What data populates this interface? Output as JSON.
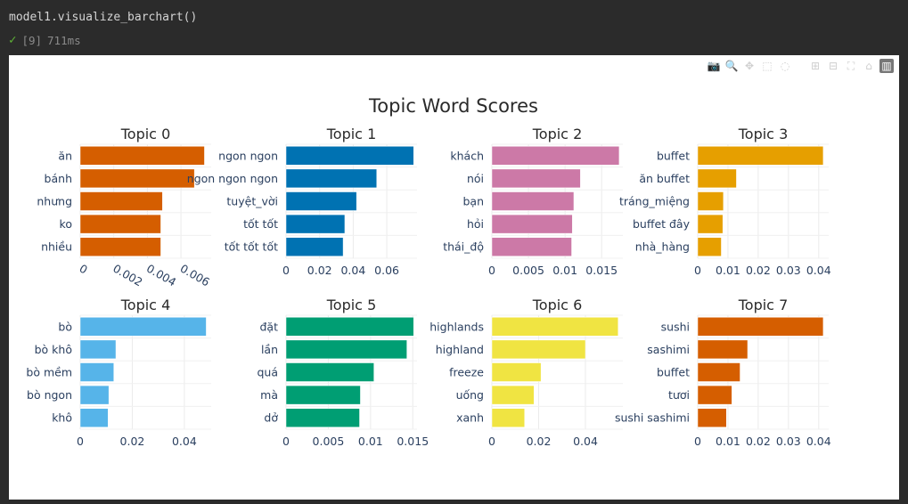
{
  "cell": {
    "code": "model1.visualize_barchart()",
    "exec_count": "[9]",
    "duration": "711ms"
  },
  "modebar_icons": [
    "camera-icon",
    "zoom-icon",
    "pan-icon",
    "box-select-icon",
    "lasso-icon",
    "zoom-in-icon",
    "zoom-out-icon",
    "autoscale-icon",
    "home-icon",
    "plotly-logo-icon"
  ],
  "chart_data": {
    "type": "bar",
    "title": "Topic Word Scores",
    "orientation": "horizontal",
    "grid": true,
    "subplots": [
      {
        "title": "Topic 0",
        "color": "#D55E00",
        "categories": [
          "ăn",
          "bánh",
          "nhưng",
          "ko",
          "nhiều"
        ],
        "values": [
          0.0074,
          0.0068,
          0.0049,
          0.0048,
          0.0048
        ],
        "xmax": 0.0078,
        "ticks": [
          0,
          0.002,
          0.004,
          0.006
        ],
        "tick_labels": [
          "0",
          "0.002",
          "0.004",
          "0.006"
        ],
        "tick_rotated": true
      },
      {
        "title": "Topic 1",
        "color": "#0072B2",
        "categories": [
          "ngon ngon",
          "ngon ngon ngon",
          "tuyệt_vời",
          "tốt tốt",
          "tốt tốt tốt"
        ],
        "values": [
          0.076,
          0.054,
          0.042,
          0.035,
          0.034
        ],
        "xmax": 0.078,
        "ticks": [
          0,
          0.02,
          0.04,
          0.06
        ],
        "tick_labels": [
          "0",
          "0.02",
          "0.04",
          "0.06"
        ]
      },
      {
        "title": "Topic 2",
        "color": "#CC79A7",
        "categories": [
          "khách",
          "nói",
          "bạn",
          "hỏi",
          "thái_độ"
        ],
        "values": [
          0.0174,
          0.0121,
          0.0112,
          0.011,
          0.0109
        ],
        "xmax": 0.0179,
        "ticks": [
          0,
          0.005,
          0.01,
          0.015
        ],
        "tick_labels": [
          "0",
          "0.005",
          "0.01",
          "0.015"
        ]
      },
      {
        "title": "Topic 3",
        "color": "#E69F00",
        "categories": [
          "buffet",
          "ăn buffet",
          "tráng_miệng",
          "buffet đây",
          "nhà_hàng"
        ],
        "values": [
          0.0415,
          0.0128,
          0.0085,
          0.0083,
          0.0078
        ],
        "xmax": 0.0433,
        "ticks": [
          0,
          0.01,
          0.02,
          0.03,
          0.04
        ],
        "tick_labels": [
          "0",
          "0.01",
          "0.02",
          "0.03",
          "0.04"
        ]
      },
      {
        "title": "Topic 4",
        "color": "#56B4E9",
        "categories": [
          "bò",
          "bò khô",
          "bò mềm",
          "bò ngon",
          "khô"
        ],
        "values": [
          0.0484,
          0.0137,
          0.0129,
          0.011,
          0.0107
        ],
        "xmax": 0.0503,
        "ticks": [
          0,
          0.02,
          0.04
        ],
        "tick_labels": [
          "0",
          "0.02",
          "0.04"
        ]
      },
      {
        "title": "Topic 5",
        "color": "#009E73",
        "categories": [
          "đặt",
          "lần",
          "quá",
          "mà",
          "dở"
        ],
        "values": [
          0.0151,
          0.0143,
          0.0104,
          0.0088,
          0.0087
        ],
        "xmax": 0.0155,
        "ticks": [
          0,
          0.005,
          0.01,
          0.015
        ],
        "tick_labels": [
          "0",
          "0.005",
          "0.01",
          "0.015"
        ]
      },
      {
        "title": "Topic 6",
        "color": "#F0E442",
        "categories": [
          "highlands",
          "highland",
          "freeze",
          "uống",
          "xanh"
        ],
        "values": [
          0.054,
          0.04,
          0.021,
          0.018,
          0.014
        ],
        "xmax": 0.056,
        "ticks": [
          0,
          0.02,
          0.04
        ],
        "tick_labels": [
          "0",
          "0.02",
          "0.04"
        ]
      },
      {
        "title": "Topic 7",
        "color": "#D55E00",
        "categories": [
          "sushi",
          "sashimi",
          "buffet",
          "tươi",
          "sushi sashimi"
        ],
        "values": [
          0.0415,
          0.0165,
          0.014,
          0.0113,
          0.0095
        ],
        "xmax": 0.0433,
        "ticks": [
          0,
          0.01,
          0.02,
          0.03,
          0.04
        ],
        "tick_labels": [
          "0",
          "0.01",
          "0.02",
          "0.03",
          "0.04"
        ]
      }
    ]
  }
}
